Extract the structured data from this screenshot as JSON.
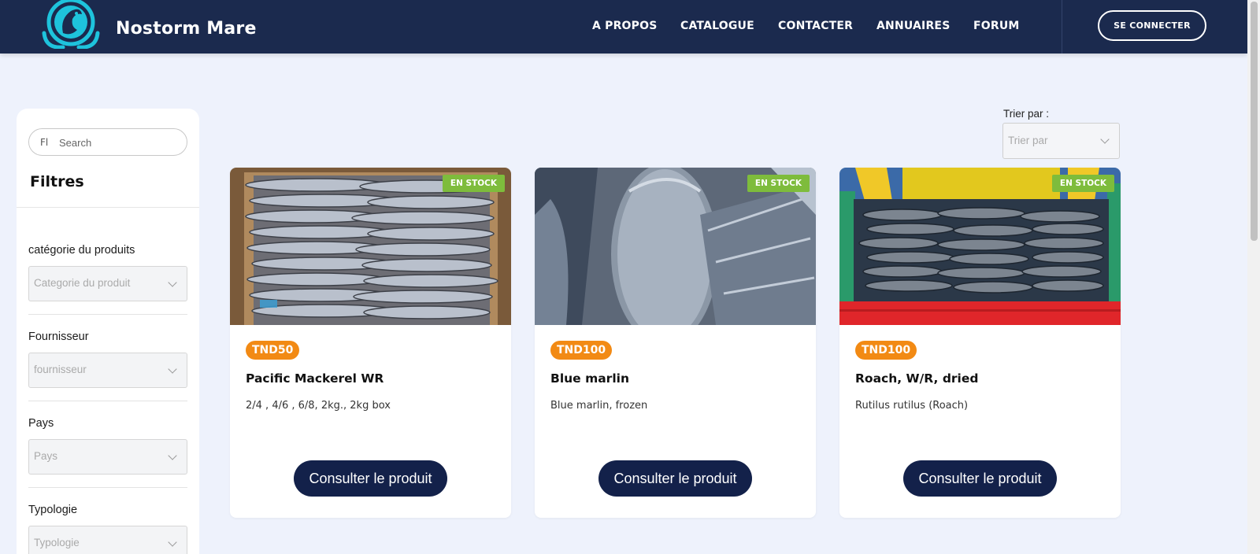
{
  "header": {
    "brand": "Nostorm Mare",
    "nav": [
      "A PROPOS",
      "CATALOGUE",
      "CONTACTER",
      "ANNUAIRES",
      "FORUM"
    ],
    "login_label": "SE CONNECTER",
    "colors": {
      "navbar": "#1b2a4e",
      "logo": "#1ec3dc"
    }
  },
  "sidebar": {
    "search_icon": "Fl",
    "search_placeholder": "Search",
    "title": "Filtres",
    "filters": [
      {
        "label": "catégorie du produits",
        "placeholder": "Categorie du produit"
      },
      {
        "label": "Fournisseur",
        "placeholder": "fournisseur"
      },
      {
        "label": "Pays",
        "placeholder": "Pays"
      },
      {
        "label": "Typologie",
        "placeholder": "Typologie"
      }
    ]
  },
  "sort": {
    "label": "Trier par :",
    "placeholder": "Trier par"
  },
  "products": [
    {
      "badge": "EN STOCK",
      "price": "TND50",
      "title": "Pacific Mackerel WR",
      "desc": "2/4 , 4/6 , 6/8, 2kg., 2kg box",
      "button": "Consulter le produit",
      "image": "boxed-mackerel"
    },
    {
      "badge": "EN STOCK",
      "price": "TND100",
      "title": "Blue marlin",
      "desc": "Blue marlin, frozen",
      "button": "Consulter le produit",
      "image": "frozen-marlin"
    },
    {
      "badge": "EN STOCK",
      "price": "TND100",
      "title": "Roach, W/R, dried",
      "desc": "Rutilus rutilus (Roach)",
      "button": "Consulter le produit",
      "image": "roach-crate"
    }
  ],
  "colors": {
    "price_badge": "#f28a14",
    "stock_badge": "#7ebc3c",
    "button": "#13214a"
  }
}
